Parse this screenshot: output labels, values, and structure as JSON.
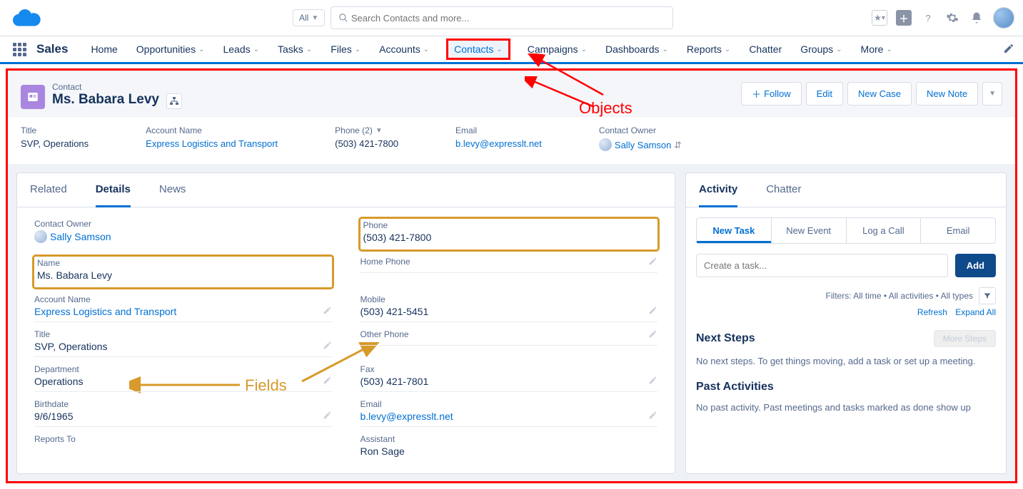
{
  "header": {
    "search_scope": "All",
    "search_placeholder": "Search Contacts and more...",
    "app_name": "Sales"
  },
  "nav": [
    {
      "label": "Home",
      "dd": false
    },
    {
      "label": "Opportunities",
      "dd": true
    },
    {
      "label": "Leads",
      "dd": true
    },
    {
      "label": "Tasks",
      "dd": true
    },
    {
      "label": "Files",
      "dd": true
    },
    {
      "label": "Accounts",
      "dd": true
    },
    {
      "label": "Contacts",
      "dd": true,
      "highlighted": true
    },
    {
      "label": "Campaigns",
      "dd": true
    },
    {
      "label": "Dashboards",
      "dd": true
    },
    {
      "label": "Reports",
      "dd": true
    },
    {
      "label": "Chatter",
      "dd": false
    },
    {
      "label": "Groups",
      "dd": true
    },
    {
      "label": "More",
      "dd": true
    }
  ],
  "record": {
    "object_label": "Contact",
    "name": "Ms. Babara Levy",
    "actions": {
      "follow": "Follow",
      "edit": "Edit",
      "new_case": "New Case",
      "new_note": "New Note"
    }
  },
  "highlights": {
    "title_label": "Title",
    "title_value": "SVP, Operations",
    "account_label": "Account Name",
    "account_value": "Express Logistics and Transport",
    "phone_label": "Phone (2)",
    "phone_value": "(503) 421-7800",
    "email_label": "Email",
    "email_value": "b.levy@expresslt.net",
    "owner_label": "Contact Owner",
    "owner_value": "Sally Samson"
  },
  "left_tabs": [
    "Related",
    "Details",
    "News"
  ],
  "details": {
    "left": [
      {
        "label": "Contact Owner",
        "value": "Sally Samson",
        "link": true
      },
      {
        "label": "Name",
        "value": "Ms. Babara Levy",
        "boxed": true
      },
      {
        "label": "Account Name",
        "value": "Express Logistics and Transport",
        "link": true,
        "editable": true
      },
      {
        "label": "Title",
        "value": "SVP, Operations",
        "editable": true
      },
      {
        "label": "Department",
        "value": "Operations",
        "editable": true
      },
      {
        "label": "Birthdate",
        "value": "9/6/1965",
        "editable": true
      },
      {
        "label": "Reports To",
        "value": ""
      }
    ],
    "right": [
      {
        "label": "Phone",
        "value": "(503) 421-7800",
        "boxed": true
      },
      {
        "label": "Home Phone",
        "value": "",
        "editable": true
      },
      {
        "label": "Mobile",
        "value": "(503) 421-5451",
        "editable": true
      },
      {
        "label": "Other Phone",
        "value": "",
        "editable": true
      },
      {
        "label": "Fax",
        "value": "(503) 421-7801",
        "editable": true
      },
      {
        "label": "Email",
        "value": "b.levy@expresslt.net",
        "link": true,
        "editable": true
      },
      {
        "label": "Assistant",
        "value": "Ron Sage"
      }
    ]
  },
  "right_panel": {
    "tabs": [
      "Activity",
      "Chatter"
    ],
    "subtabs": [
      "New Task",
      "New Event",
      "Log a Call",
      "Email"
    ],
    "task_placeholder": "Create a task...",
    "add_label": "Add",
    "filters_text": "Filters: All time • All activities • All types",
    "refresh": "Refresh",
    "expand": "Expand All",
    "next_steps_title": "Next Steps",
    "more_steps": "More Steps",
    "next_steps_body": "No next steps. To get things moving, add a task or set up a meeting.",
    "past_title": "Past Activities",
    "past_body": "No past activity. Past meetings and tasks marked as done show up"
  },
  "annotations": {
    "objects": "Objects",
    "fields": "Fields"
  }
}
